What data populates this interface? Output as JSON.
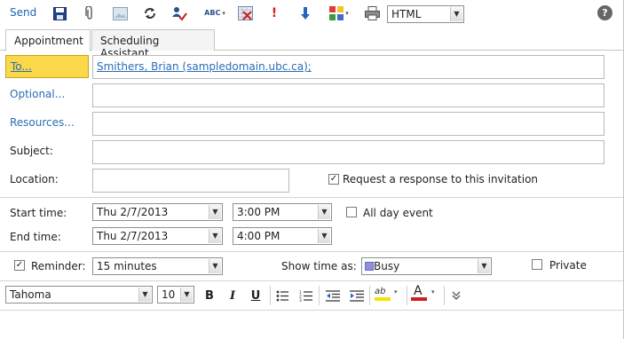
{
  "toolbar": {
    "send_label": "Send",
    "icons": [
      "save-icon",
      "attach-icon",
      "insert-image-icon",
      "recurrence-icon",
      "check-names-icon",
      "spell-check-icon",
      "cancel-invitation-icon",
      "high-importance-icon",
      "low-importance-icon",
      "categories-icon",
      "print-icon",
      "help-icon"
    ],
    "format_value": "HTML",
    "help_glyph": "?",
    "spell_glyph": "ABC"
  },
  "tabs": [
    {
      "label": "Appointment",
      "active": true
    },
    {
      "label": "Scheduling Assistant",
      "active": false
    }
  ],
  "fields": {
    "to_label": "To...",
    "to_recipient": "Smithers, Brian (sampledomain.ubc.ca)",
    "to_separator": ";",
    "optional_label": "Optional...",
    "resources_label": "Resources...",
    "subject_label": "Subject:",
    "subject_value": "",
    "location_label": "Location:",
    "location_value": "",
    "request_response_label": "Request a response to this invitation",
    "request_response_checked": true
  },
  "time": {
    "start_label": "Start time:",
    "start_date": "Thu 2/7/2013",
    "start_time": "3:00 PM",
    "end_label": "End time:",
    "end_date": "Thu 2/7/2013",
    "end_time": "4:00 PM",
    "all_day_label": "All day event",
    "all_day_checked": false
  },
  "options": {
    "reminder_label": "Reminder:",
    "reminder_checked": true,
    "reminder_value": "15 minutes",
    "show_time_label": "Show time as:",
    "show_time_value": "Busy",
    "busy_color": "#8f8fe0",
    "private_label": "Private",
    "private_checked": false
  },
  "formatting": {
    "font_value": "Tahoma",
    "size_value": "10",
    "bold": "B",
    "italic": "I",
    "underline": "U",
    "font_color_glyph": "A",
    "highlight_glyph": "ab",
    "highlight_color": "#f2e400",
    "font_color": "#d11f1f",
    "accent_color": "#1e62b0"
  }
}
